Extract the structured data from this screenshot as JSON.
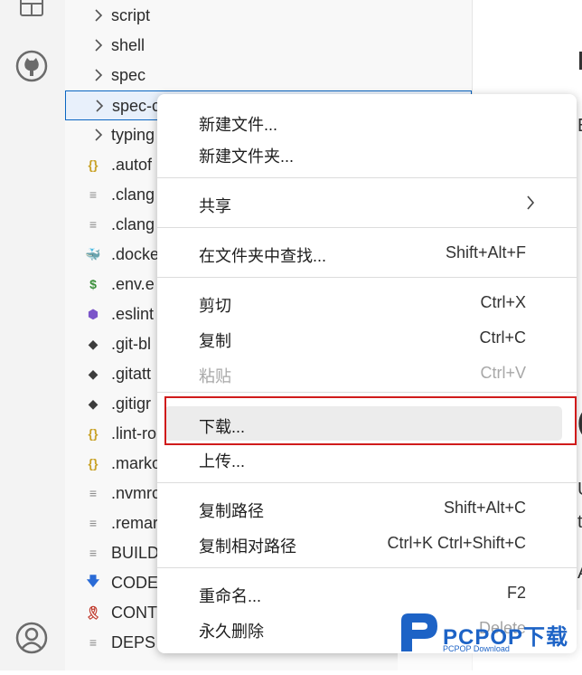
{
  "explorer": {
    "items": [
      {
        "label": "script",
        "icon": "chevron-right-icon",
        "color": "#555"
      },
      {
        "label": "shell",
        "icon": "chevron-right-icon",
        "color": "#555"
      },
      {
        "label": "spec",
        "icon": "chevron-right-icon",
        "color": "#555"
      },
      {
        "label": "spec-c",
        "icon": "chevron-right-icon",
        "color": "#555",
        "selected": true
      },
      {
        "label": "typing",
        "icon": "chevron-right-icon",
        "color": "#555"
      },
      {
        "label": ".autof",
        "icon": "json-braces-icon",
        "glyph": "{}",
        "color": "#c9a227"
      },
      {
        "label": ".clang",
        "icon": "text-file-icon",
        "glyph": "≡",
        "color": "#8a8a8a"
      },
      {
        "label": ".clang",
        "icon": "text-file-icon",
        "glyph": "≡",
        "color": "#8a8a8a"
      },
      {
        "label": ".docke",
        "icon": "docker-icon",
        "glyph": "🐳",
        "color": "#0d6fb3"
      },
      {
        "label": ".env.e",
        "icon": "dollar-icon",
        "glyph": "$",
        "color": "#3a8f3a"
      },
      {
        "label": ".eslint",
        "icon": "eslint-icon",
        "glyph": "⬢",
        "color": "#7b55c9"
      },
      {
        "label": ".git-bl",
        "icon": "git-icon",
        "glyph": "◆",
        "color": "#3c3c3c"
      },
      {
        "label": ".gitatt",
        "icon": "git-icon",
        "glyph": "◆",
        "color": "#3c3c3c"
      },
      {
        "label": ".gitigr",
        "icon": "git-icon",
        "glyph": "◆",
        "color": "#3c3c3c"
      },
      {
        "label": ".lint-ro",
        "icon": "json-braces-icon",
        "glyph": "{}",
        "color": "#c9a227"
      },
      {
        "label": ".marko",
        "icon": "json-braces-icon",
        "glyph": "{}",
        "color": "#c9a227"
      },
      {
        "label": ".nvmrc",
        "icon": "text-file-icon",
        "glyph": "≡",
        "color": "#8a8a8a"
      },
      {
        "label": ".remar",
        "icon": "text-file-icon",
        "glyph": "≡",
        "color": "#8a8a8a"
      },
      {
        "label": "BUILD",
        "icon": "text-file-icon",
        "glyph": "≡",
        "color": "#8a8a8a"
      },
      {
        "label": "CODE_",
        "icon": "download-arrow-icon",
        "glyph": "🡇",
        "color": "#2a6bd6"
      },
      {
        "label": "CONT",
        "icon": "ribbon-icon",
        "glyph": "🎗",
        "color": "#c0392b"
      },
      {
        "label": "DEPS",
        "icon": "text-file-icon",
        "glyph": "≡",
        "color": "#8a8a8a"
      }
    ]
  },
  "context_menu": {
    "items": [
      {
        "label": "新建文件...",
        "shortcut": ""
      },
      {
        "label": "新建文件夹...",
        "shortcut": ""
      },
      {
        "label": "共享",
        "shortcut": "",
        "submenu": true
      },
      {
        "label": "在文件夹中查找...",
        "shortcut": "Shift+Alt+F"
      },
      {
        "label": "剪切",
        "shortcut": "Ctrl+X"
      },
      {
        "label": "复制",
        "shortcut": "Ctrl+C"
      },
      {
        "label": "粘贴",
        "shortcut": "Ctrl+V",
        "disabled": true
      },
      {
        "label": "下载...",
        "shortcut": "",
        "hover": true
      },
      {
        "label": "上传...",
        "shortcut": ""
      },
      {
        "label": "复制路径",
        "shortcut": "Shift+Alt+C"
      },
      {
        "label": "复制相对路径",
        "shortcut": "Ctrl+K Ctrl+Shift+C"
      },
      {
        "label": "重命名...",
        "shortcut": "F2"
      },
      {
        "label": "永久删除",
        "shortcut": "Delete"
      }
    ]
  },
  "editor": {
    "fragments": [
      "l",
      "E",
      "(",
      "U",
      "t",
      "A"
    ]
  },
  "watermark": {
    "brand": "PCPOP下载",
    "sub": "PCPOP Download"
  },
  "colors": {
    "selection_border": "#0a66c2",
    "highlight_red": "#d01b1b",
    "watermark_blue": "#1d63c6"
  }
}
